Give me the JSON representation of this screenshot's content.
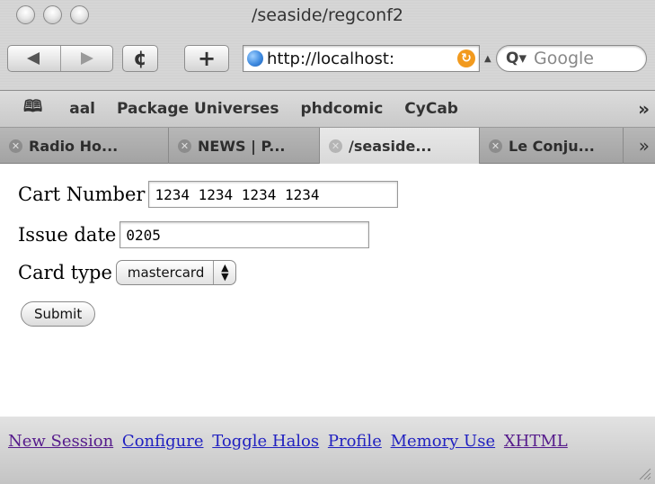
{
  "window": {
    "title": "/seaside/regconf2"
  },
  "toolbar": {
    "back_icon": "back-arrow-icon",
    "forward_icon": "forward-arrow-icon",
    "reload_glyph": "¢",
    "add_bookmark_glyph": "+",
    "address_value": "http://localhost:",
    "search_placeholder": "Google"
  },
  "bookmarks": {
    "items": [
      "aal",
      "Package Universes",
      "phdcomic",
      "CyCab"
    ]
  },
  "tabs": [
    {
      "label": "Radio Ho...",
      "active": false
    },
    {
      "label": "NEWS | P...",
      "active": false
    },
    {
      "label": "/seaside...",
      "active": true
    },
    {
      "label": "Le Conju...",
      "active": false
    }
  ],
  "form": {
    "card_number_label": "Cart Number",
    "card_number_value": "1234 1234 1234 1234",
    "issue_date_label": "Issue date",
    "issue_date_value": "0205",
    "card_type_label": "Card type",
    "card_type_value": "mastercard",
    "submit_label": "Submit"
  },
  "footer": {
    "links": [
      "New Session",
      "Configure",
      "Toggle Halos",
      "Profile",
      "Memory Use",
      "XHTML"
    ]
  },
  "colors": {
    "link": "#2020c0",
    "visited_link": "#551a8b",
    "rss": "#f29a1e"
  }
}
